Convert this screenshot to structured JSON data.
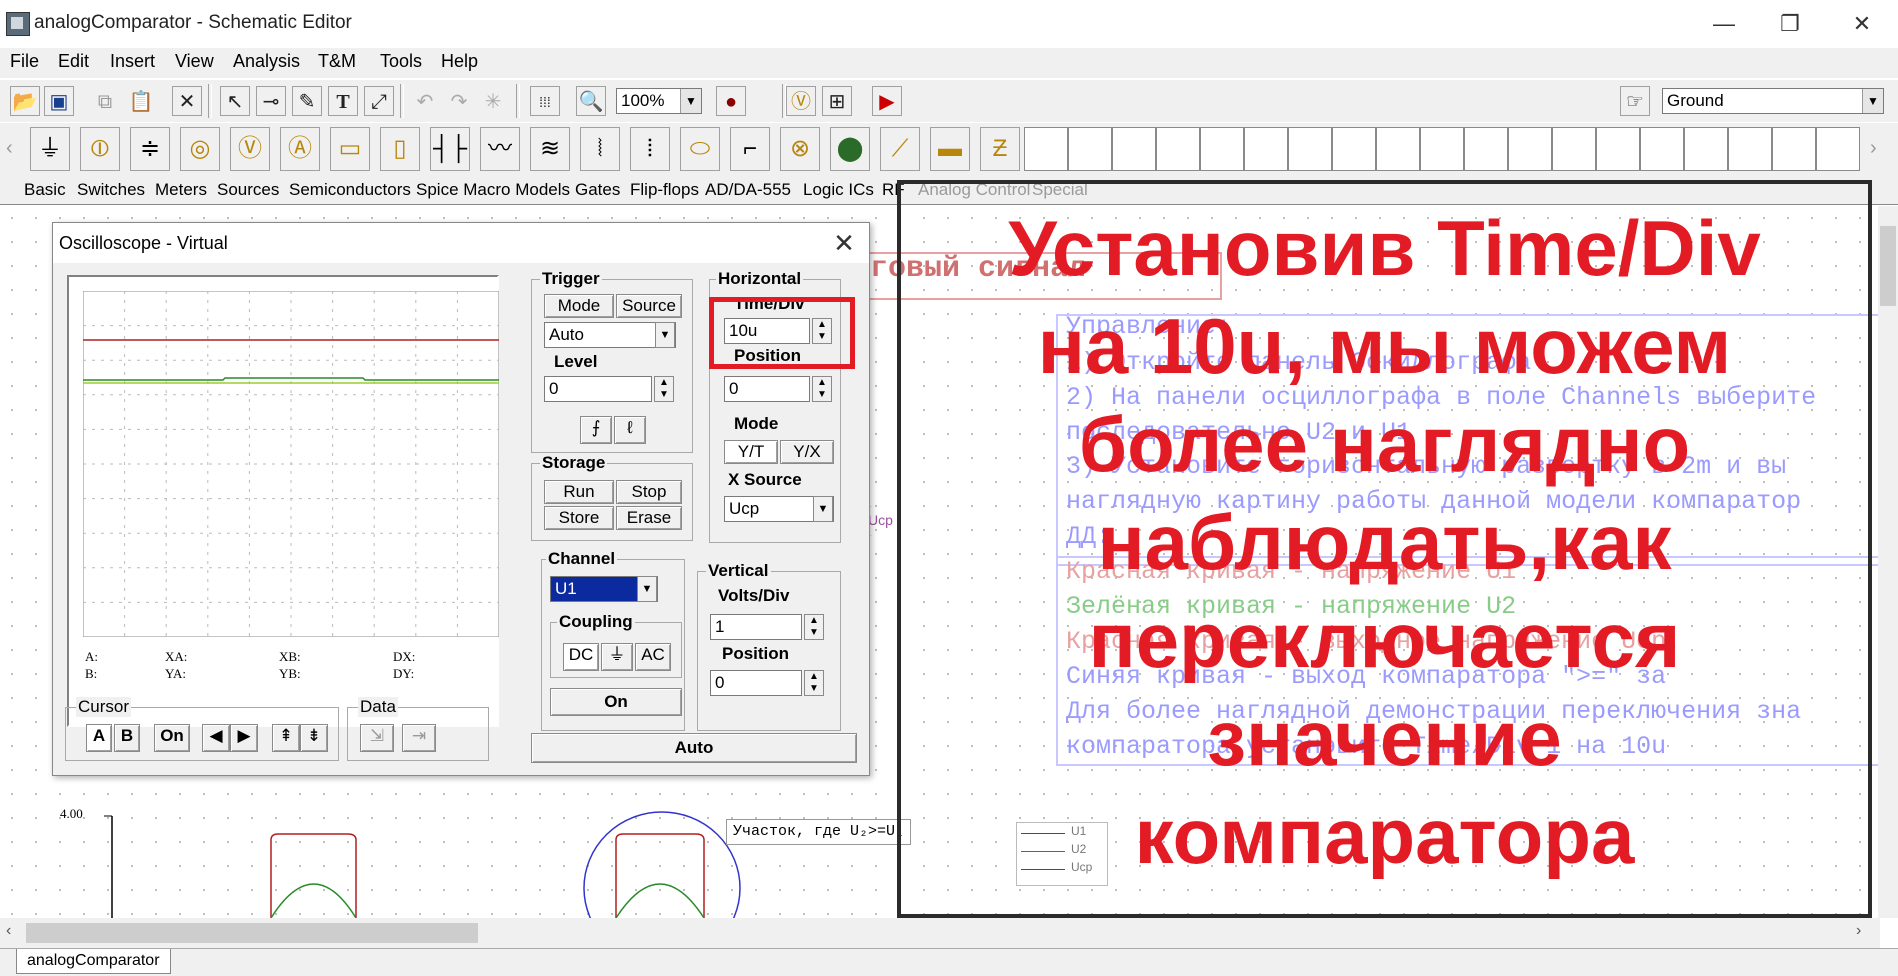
{
  "window": {
    "title": "analogComparator - Schematic Editor",
    "minimize": "—",
    "restore": "❐",
    "close": "✕"
  },
  "menu": [
    "File",
    "Edit",
    "Insert",
    "View",
    "Analysis",
    "T&M",
    "Tools",
    "Help"
  ],
  "toolbar": {
    "zoom": "100%",
    "ground_select": "Ground"
  },
  "tabs": [
    "Basic",
    "Switches",
    "Meters",
    "Sources",
    "Semiconductors",
    "Spice Macro Models",
    "Gates",
    "Flip-flops",
    "AD/DA-555",
    "Logic ICs",
    "RF",
    "Analog Control",
    "Special"
  ],
  "oscilloscope": {
    "title": "Oscilloscope - Virtual",
    "close": "✕",
    "readout": {
      "a": "A:",
      "b": "B:",
      "xa": "XA:",
      "ya": "YA:",
      "xb": "XB:",
      "yb": "YB:",
      "dx": "DX:",
      "dy": "DY:"
    },
    "trigger": {
      "label": "Trigger",
      "mode": "Mode",
      "source": "Source",
      "mode_value": "Auto",
      "level_label": "Level",
      "level_value": "0"
    },
    "horizontal": {
      "label": "Horizontal",
      "time_div_label": "Time/Div",
      "time_div_value": "10u",
      "position_label": "Position",
      "position_value": "0",
      "mode_label": "Mode",
      "yt": "Y/T",
      "yx": "Y/X",
      "xsource_label": "X Source",
      "xsource_value": "Ucp"
    },
    "storage": {
      "label": "Storage",
      "run": "Run",
      "stop": "Stop",
      "store": "Store",
      "erase": "Erase"
    },
    "channel": {
      "label": "Channel",
      "value": "U1",
      "coupling_label": "Coupling",
      "dc": "DC",
      "ac": "AC",
      "on": "On"
    },
    "vertical": {
      "label": "Vertical",
      "volts_div_label": "Volts/Div",
      "volts_div_value": "1",
      "position_label": "Position",
      "position_value": "0"
    },
    "cursor": {
      "label": "Cursor",
      "a": "A",
      "b": "B",
      "on": "On"
    },
    "data": {
      "label": "Data"
    },
    "auto": "Auto"
  },
  "schematic": {
    "header_fragment": "говый сигнал",
    "probe_label": "Ucp",
    "lines": [
      "Управление:",
      "1) Откройте панель Оскиллографа",
      "2) На панели осциллографа в поле Channels выберите",
      "последовательно U2 и U1",
      "3) Установите горизонтальную развертку в 2m и вы",
      "наглядную картину работы данной модели компаратор",
      "ДД:",
      "Красная кривая - напряжение U1",
      "Зелёная кривая - напряжение U2",
      "Красная кривая - выходное напряжение Ucp.",
      "Синяя кривая - выход компаратора \">=\" за",
      "Для более наглядной демонстрации переключения зна",
      "компаратора установите Time/Div 1 на 10u"
    ],
    "graph_ymax": "4.00",
    "annotation": "Участок, где U₂>=U₁",
    "legend": [
      "U1",
      "U2",
      "Ucp"
    ]
  },
  "overlay": {
    "lines": [
      "Установив Time/Div",
      "на 10u, мы можем",
      "более наглядно",
      "наблюдать,как",
      "переключается",
      "значение",
      "компаратора"
    ],
    "color": "#e31b25"
  },
  "status": {
    "tab": "analogComparator"
  }
}
